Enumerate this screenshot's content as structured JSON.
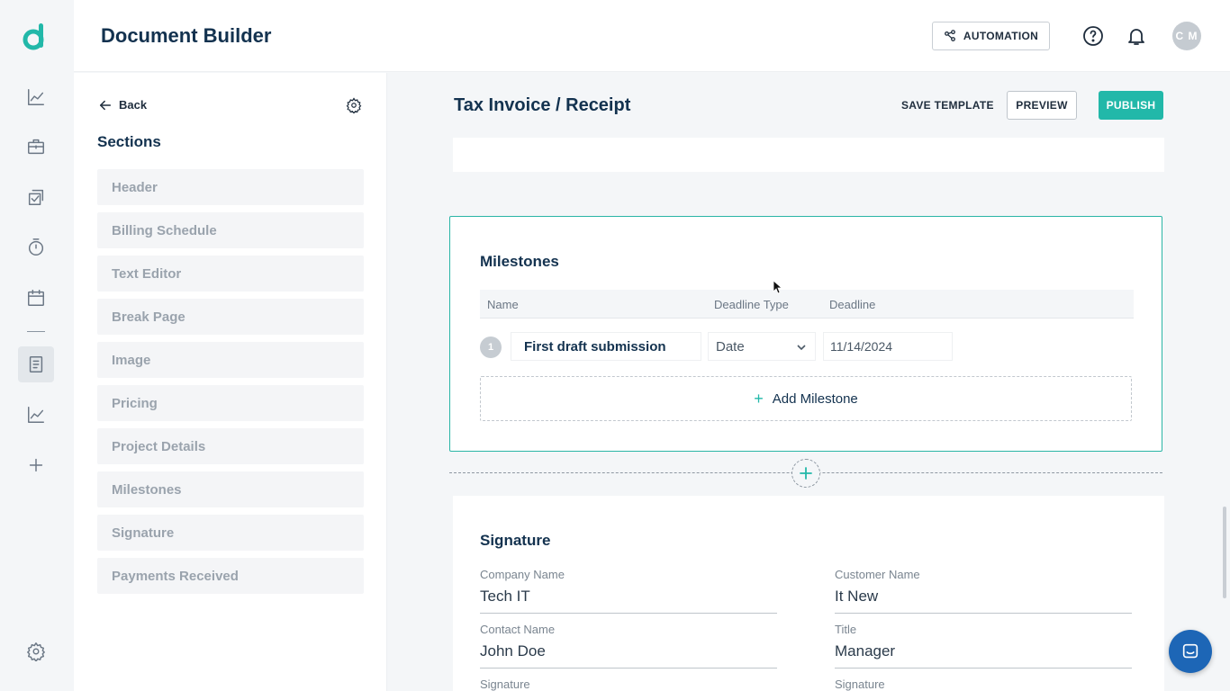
{
  "app": {
    "title": "Document Builder"
  },
  "header": {
    "automation_label": "AUTOMATION",
    "avatar_initials": "C M",
    "icons": [
      "help-icon",
      "bell-icon"
    ]
  },
  "rail": {
    "icons": [
      "logo",
      "analytics-icon",
      "briefcase-icon",
      "checklist-icon",
      "timer-icon",
      "calendar-icon",
      "document-icon",
      "chart-icon",
      "plus-icon",
      "settings-icon"
    ],
    "active": "document-icon"
  },
  "sections_panel": {
    "back_label": "Back",
    "heading": "Sections",
    "items": [
      {
        "label": "Header"
      },
      {
        "label": "Billing Schedule"
      },
      {
        "label": "Text Editor"
      },
      {
        "label": "Break Page"
      },
      {
        "label": "Image"
      },
      {
        "label": "Pricing"
      },
      {
        "label": "Project Details"
      },
      {
        "label": "Milestones"
      },
      {
        "label": "Signature"
      },
      {
        "label": "Payments Received"
      }
    ]
  },
  "document": {
    "title": "Tax Invoice / Receipt",
    "save_template_label": "SAVE TEMPLATE",
    "preview_label": "PREVIEW",
    "publish_label": "PUBLISH"
  },
  "milestones": {
    "title": "Milestones",
    "columns": [
      "Name",
      "Deadline Type",
      "Deadline"
    ],
    "rows": [
      {
        "index": "1",
        "name": "First draft submission",
        "deadline_type": "Date",
        "deadline": "11/14/2024"
      }
    ],
    "add_label": "Add Milestone"
  },
  "signature": {
    "title": "Signature",
    "fields": [
      {
        "label": "Company Name",
        "value": "Tech IT"
      },
      {
        "label": "Customer Name",
        "value": "It New"
      },
      {
        "label": "Contact Name",
        "value": "John Doe"
      },
      {
        "label": "Title",
        "value": "Manager"
      },
      {
        "label": "Signature",
        "value": ""
      },
      {
        "label": "Signature",
        "value": ""
      }
    ]
  },
  "colors": {
    "accent": "#22b8a9",
    "heading": "#13324f",
    "chat": "#1d66b6"
  }
}
